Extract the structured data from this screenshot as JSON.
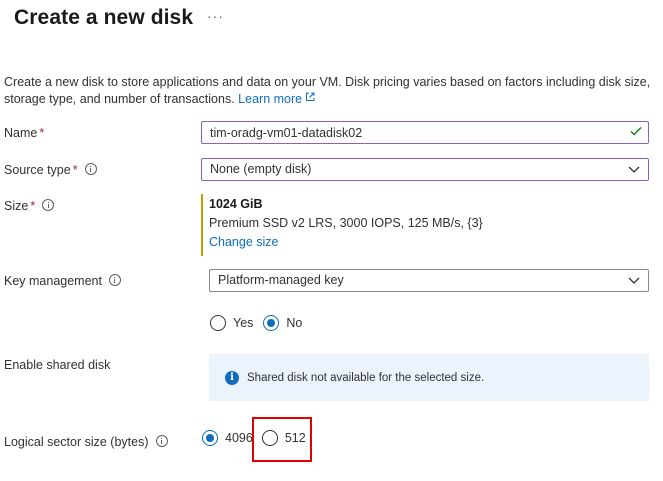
{
  "page": {
    "title": "Create a new disk",
    "more_label": "···"
  },
  "description": {
    "text": "Create a new disk to store applications and data on your VM. Disk pricing varies based on factors including disk size, storage type, and number of transactions. ",
    "link_label": "Learn more"
  },
  "form": {
    "name": {
      "label": "Name",
      "required_mark": "*",
      "value": "tim-oradg-vm01-datadisk02"
    },
    "source_type": {
      "label": "Source type",
      "required_mark": "*",
      "value": "None (empty disk)"
    },
    "size": {
      "label": "Size",
      "required_mark": "*",
      "value": "1024 GiB",
      "detail": "Premium SSD v2 LRS, 3000 IOPS, 125 MB/s, {3}",
      "change_link": "Change size"
    },
    "key_management": {
      "label": "Key management",
      "value": "Platform-managed key"
    },
    "shared_disk": {
      "label": "Enable shared disk",
      "options": [
        "Yes",
        "No"
      ],
      "selected": "No",
      "info_message": "Shared disk not available for the selected size."
    },
    "logical_sector_size": {
      "label": "Logical sector size (bytes)",
      "options": [
        "4096",
        "512"
      ],
      "selected": "4096"
    }
  },
  "colors": {
    "accent": "#0f6cbd",
    "required": "#a4262c",
    "focus_border": "#8764b8",
    "highlight": "#e00000",
    "banner_bg": "#ebf3fc",
    "check": "#107c10"
  }
}
